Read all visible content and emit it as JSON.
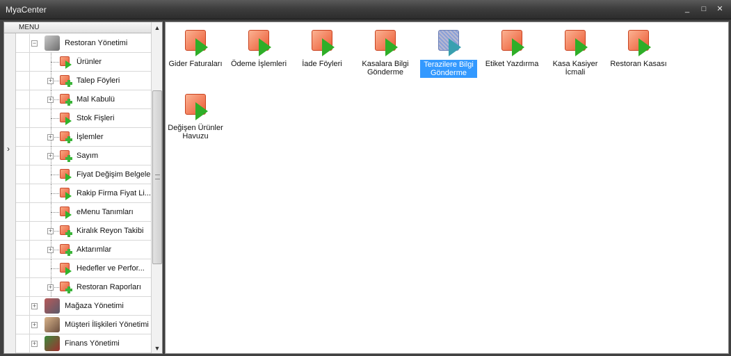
{
  "window": {
    "title": "MyaCenter",
    "minimize_glyph": "_",
    "maximize_glyph": "□",
    "close_glyph": "✕"
  },
  "tree": {
    "header": "MENU",
    "current_row_indicator": "›",
    "items": [
      {
        "label": "Restoran Yönetimi",
        "level": 0,
        "icon": "restaurant-photo-icon",
        "expander": "−"
      },
      {
        "label": "Ürünler",
        "level": 1,
        "icon": "run-icon",
        "expander": ""
      },
      {
        "label": "Talep Föyleri",
        "level": 1,
        "icon": "add-icon",
        "expander": "+"
      },
      {
        "label": "Mal Kabulü",
        "level": 1,
        "icon": "add-icon",
        "expander": "+"
      },
      {
        "label": "Stok Fişleri",
        "level": 1,
        "icon": "run-icon",
        "expander": ""
      },
      {
        "label": "İşlemler",
        "level": 1,
        "icon": "add-icon",
        "expander": "+"
      },
      {
        "label": "Sayım",
        "level": 1,
        "icon": "add-icon",
        "expander": "+"
      },
      {
        "label": "Fiyat Değişim Belgeleri",
        "level": 1,
        "icon": "run-icon",
        "expander": ""
      },
      {
        "label": "Rakip Firma Fiyat Li...",
        "level": 1,
        "icon": "run-icon",
        "expander": ""
      },
      {
        "label": "eMenu Tanımları",
        "level": 1,
        "icon": "run-icon",
        "expander": ""
      },
      {
        "label": "Kiralık Reyon Takibi",
        "level": 1,
        "icon": "add-icon",
        "expander": "+"
      },
      {
        "label": "Aktarımlar",
        "level": 1,
        "icon": "add-icon",
        "expander": "+"
      },
      {
        "label": "Hedefler ve Perfor...",
        "level": 1,
        "icon": "run-icon",
        "expander": ""
      },
      {
        "label": "Restoran Raporları",
        "level": 1,
        "icon": "add-icon",
        "expander": "+"
      },
      {
        "label": "Mağaza Yönetimi",
        "level": 0,
        "icon": "store-photo-icon",
        "expander": "+"
      },
      {
        "label": "Müşteri İlişkileri Yönetimi",
        "level": 0,
        "icon": "crm-photo-icon",
        "expander": "+"
      },
      {
        "label": "Finans Yönetimi",
        "level": 0,
        "icon": "finance-photo-icon",
        "expander": "+"
      }
    ]
  },
  "scroll": {
    "up_glyph": "▲",
    "down_glyph": "▼"
  },
  "tiles": [
    {
      "label": "Gider Faturaları",
      "selected": false
    },
    {
      "label": "Ödeme İşlemleri",
      "selected": false
    },
    {
      "label": "İade Föyleri",
      "selected": false
    },
    {
      "label": "Kasalara Bilgi Gönderme",
      "selected": false
    },
    {
      "label": "Terazilere Bilgi Gönderme",
      "selected": true
    },
    {
      "label": "Etiket Yazdırma",
      "selected": false
    },
    {
      "label": "Kasa Kasiyer İcmali",
      "selected": false
    },
    {
      "label": "Restoran Kasası",
      "selected": false
    },
    {
      "label": "Değişen Ürünler Havuzu",
      "selected": false
    }
  ]
}
